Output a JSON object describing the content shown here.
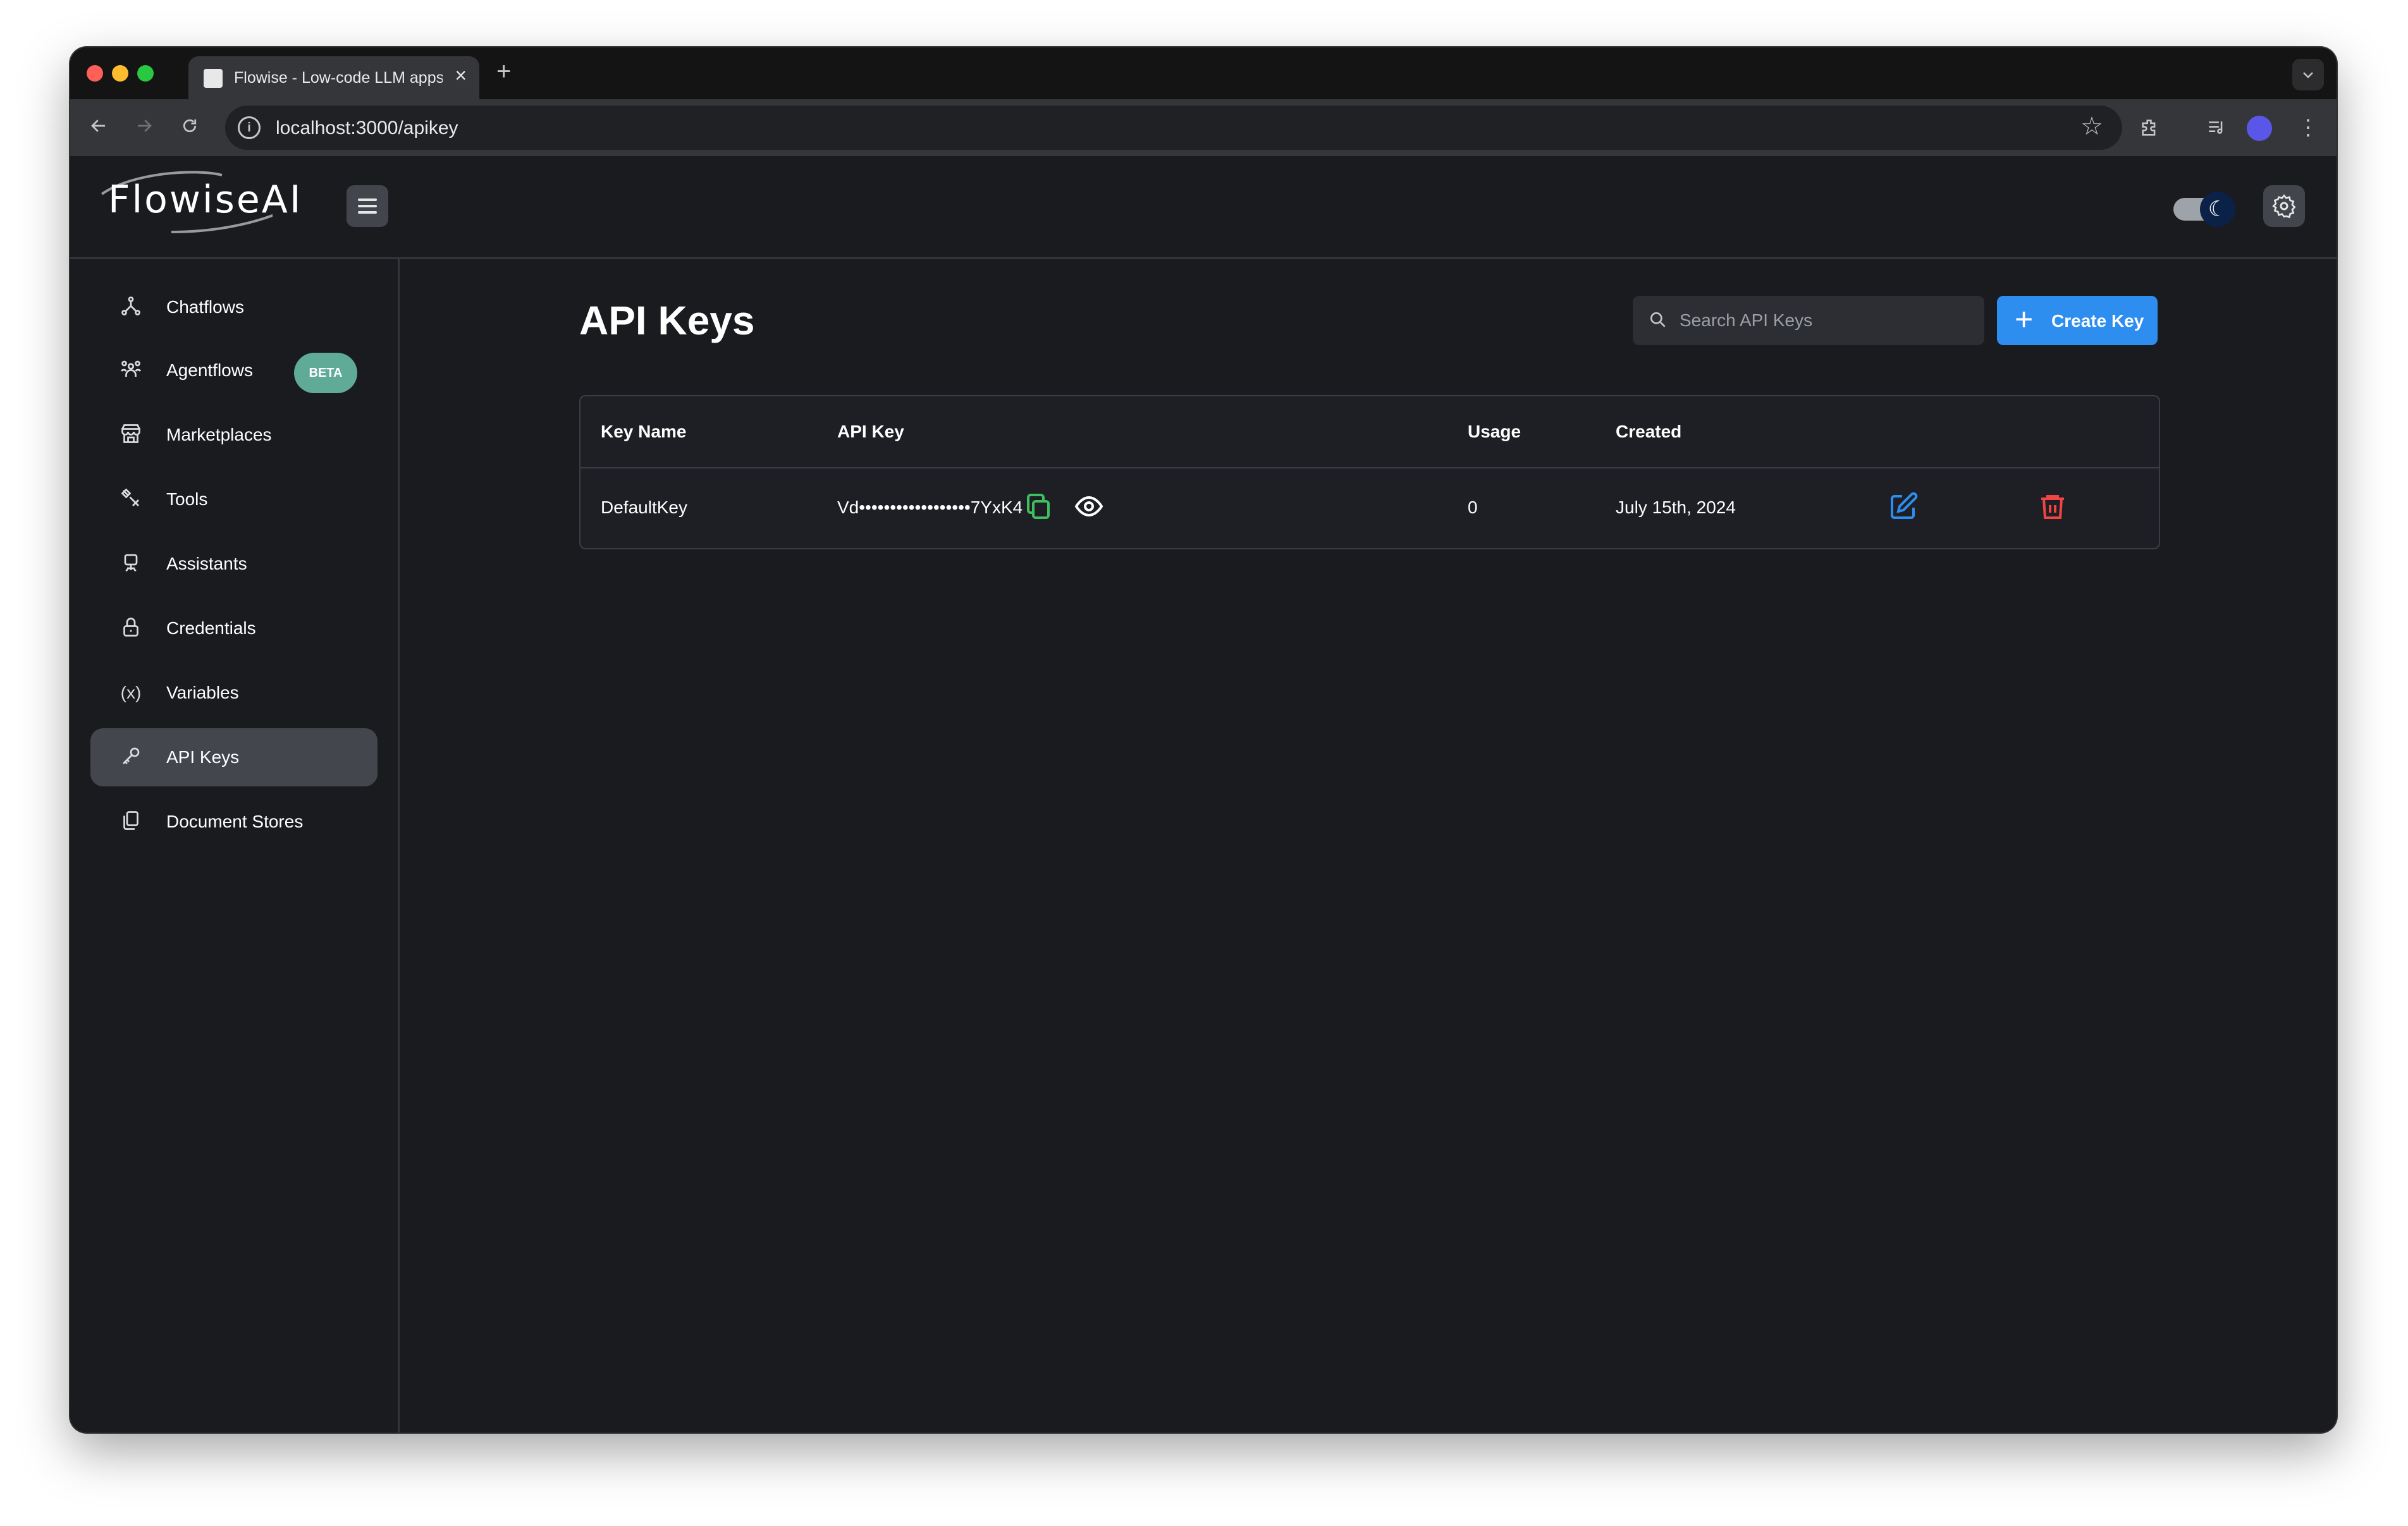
{
  "browser": {
    "tab_title": "Flowise - Low-code LLM apps",
    "tab_close": "×",
    "new_tab": "+",
    "url": "localhost:3000/apikey"
  },
  "app": {
    "logo_text": "FlowiseAI"
  },
  "sidebar": {
    "items": [
      {
        "label": "Chatflows",
        "icon": "chatflows-icon"
      },
      {
        "label": "Agentflows",
        "icon": "agentflows-icon",
        "badge": "BETA"
      },
      {
        "label": "Marketplaces",
        "icon": "marketplace-icon"
      },
      {
        "label": "Tools",
        "icon": "tools-icon"
      },
      {
        "label": "Assistants",
        "icon": "assistants-icon"
      },
      {
        "label": "Credentials",
        "icon": "lock-icon"
      },
      {
        "label": "Variables",
        "icon": "variables-icon"
      },
      {
        "label": "API Keys",
        "icon": "key-icon",
        "active": true
      },
      {
        "label": "Document Stores",
        "icon": "document-stores-icon"
      }
    ]
  },
  "main": {
    "title": "API Keys",
    "search_placeholder": "Search API Keys",
    "create_label": "Create Key",
    "table": {
      "headers": [
        "Key Name",
        "API Key",
        "Usage",
        "Created"
      ],
      "rows": [
        {
          "name": "DefaultKey",
          "key": "Vd••••••••••••••••••7YxK4",
          "usage": "0",
          "created": "July 15th, 2024"
        }
      ]
    }
  },
  "colors": {
    "background": "#1a1b1f",
    "accent": "#2e8ef0",
    "beta_badge": "#5fab98",
    "copy_icon": "#3fbf5e",
    "edit_icon": "#2e8ef0",
    "delete_icon": "#f24444"
  }
}
